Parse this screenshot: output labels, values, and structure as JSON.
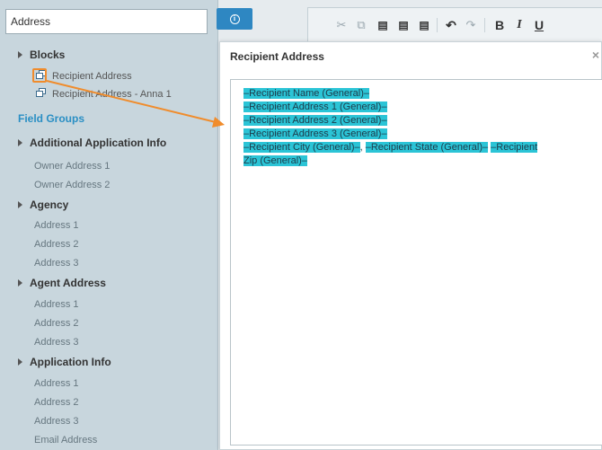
{
  "search": {
    "value": "Address"
  },
  "info_button": {
    "icon": "info-icon"
  },
  "tree": {
    "blocks_label": "Blocks",
    "blocks": [
      "Recipient Address",
      "Recipient Address - Anna 1"
    ],
    "field_groups_label": "Field Groups",
    "groups": [
      {
        "label": "Additional Application Info",
        "items": [
          "Owner Address 1",
          "Owner Address 2"
        ]
      },
      {
        "label": "Agency",
        "items": [
          "Address 1",
          "Address 2",
          "Address 3"
        ]
      },
      {
        "label": "Agent Address",
        "items": [
          "Address 1",
          "Address 2",
          "Address 3"
        ]
      },
      {
        "label": "Application Info",
        "items": [
          "Address 1",
          "Address 2",
          "Address 3",
          "Email Address"
        ]
      }
    ]
  },
  "toolbar": {
    "icons": [
      "cut-icon",
      "copy-icon",
      "paste-icon",
      "paste-text-icon",
      "paste-word-icon",
      "undo-icon",
      "redo-icon",
      "bold-icon",
      "italic-icon",
      "underline-icon"
    ],
    "bold": "B",
    "italic": "I",
    "underline": "U"
  },
  "dialog": {
    "title": "Recipient Address",
    "close": "×",
    "lines": [
      "–Recipient Name (General)–",
      "–Recipient Address 1 (General)–",
      "–Recipient Address 2 (General)–",
      "–Recipient Address 3 (General)–"
    ],
    "line5": {
      "city": "–Recipient City (General)–",
      "comma": ",",
      "state": "–Recipient State (General)–",
      "zip_start": "–Recipient"
    },
    "line6": "Zip (General)–"
  },
  "colors": {
    "accent": "#2e87c2",
    "field_token_highlight": "#2bc4d6",
    "annotation": "#f08c2c",
    "panel": "#c8d6dd"
  }
}
